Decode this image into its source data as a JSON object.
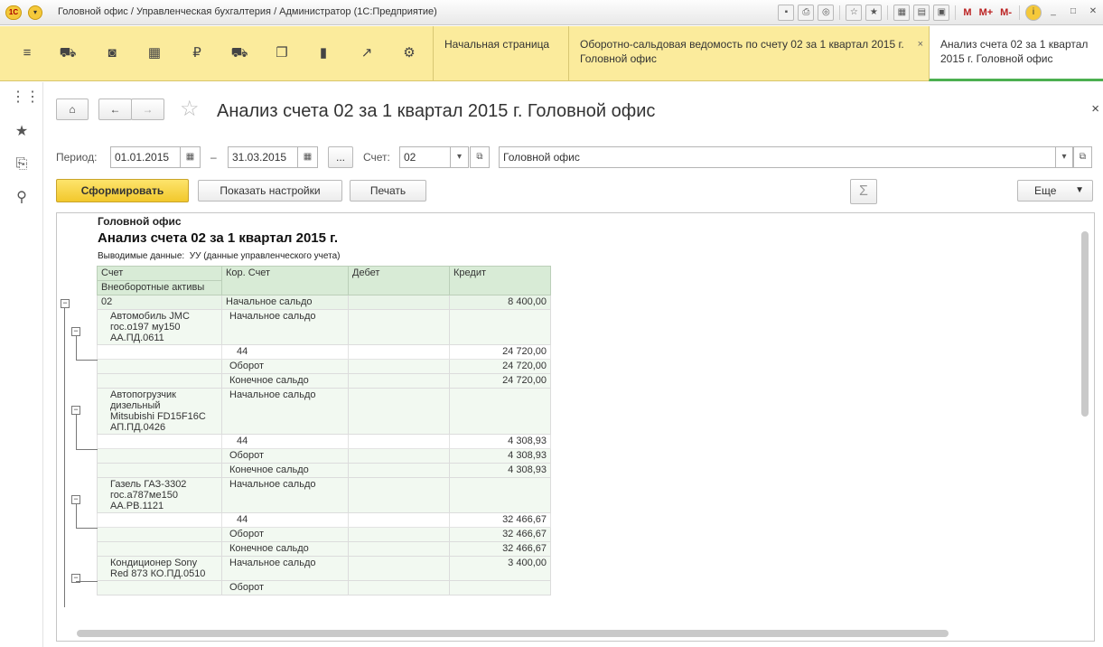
{
  "window": {
    "title": "Головной офис / Управленческая бухгалтерия / Администратор  (1С:Предприятие)",
    "logo_text": "1С",
    "toolbar_labels": [
      "M",
      "M+",
      "M-"
    ]
  },
  "top_sections": {
    "tabs": [
      {
        "label": "Начальная страница"
      },
      {
        "label": "Оборотно-сальдовая ведомость по счету 02 за 1 квартал 2015 г. Головной офис",
        "close": "×"
      },
      {
        "label": "Анализ счета 02 за 1 квартал 2015 г. Головной офис"
      }
    ]
  },
  "form": {
    "title": "Анализ счета 02 за 1 квартал 2015 г. Головной офис",
    "close": "×",
    "period_label": "Период:",
    "date_from": "01.01.2015",
    "dash": "–",
    "date_to": "31.03.2015",
    "ellipsis": "...",
    "account_label": "Счет:",
    "account": "02",
    "organization": "Головной офис",
    "generate_btn": "Сформировать",
    "settings_btn": "Показать настройки",
    "print_btn": "Печать",
    "sum_icon": "Σ",
    "more_btn": "Еще"
  },
  "report": {
    "org": "Головной офис",
    "title": "Анализ счета 02 за 1 квартал 2015 г.",
    "output_line": "Выводимые данные:  УУ (данные управленческого учета)",
    "headers": {
      "account": "Счет",
      "corr": "Кор. Счет",
      "debit": "Дебет",
      "credit": "Кредит",
      "group": "Внеоборотные активы"
    },
    "rows": [
      {
        "kind": "acc",
        "c1": "02",
        "c2": "Начальное сальдо",
        "c3": "",
        "c4": "8 400,00"
      },
      {
        "kind": "sub",
        "c1": "Автомобиль JMC\nгос.о197 му150\nАА.ПД.0611",
        "c2": "Начальное сальдо",
        "c3": "",
        "c4": "",
        "lines": 3
      },
      {
        "kind": "plain",
        "c1": "",
        "c2": "44",
        "c3": "",
        "c4": "24 720,00",
        "indent": true
      },
      {
        "kind": "sub",
        "c1": "",
        "c2": "Оборот",
        "c3": "",
        "c4": "24 720,00"
      },
      {
        "kind": "sub",
        "c1": "",
        "c2": "Конечное сальдо",
        "c3": "",
        "c4": "24 720,00"
      },
      {
        "kind": "sub",
        "c1": "Автопогрузчик\nдизельный\nMitsubishi FD15F16C\nАП.ПД.0426",
        "c2": "Начальное сальдо",
        "c3": "",
        "c4": "",
        "lines": 4
      },
      {
        "kind": "plain",
        "c1": "",
        "c2": "44",
        "c3": "",
        "c4": "4 308,93",
        "indent": true
      },
      {
        "kind": "sub",
        "c1": "",
        "c2": "Оборот",
        "c3": "",
        "c4": "4 308,93"
      },
      {
        "kind": "sub",
        "c1": "",
        "c2": "Конечное сальдо",
        "c3": "",
        "c4": "4 308,93"
      },
      {
        "kind": "sub",
        "c1": "Газель ГАЗ-3302\nгос.а787ме150\nАА.РВ.1121",
        "c2": "Начальное сальдо",
        "c3": "",
        "c4": "",
        "lines": 3
      },
      {
        "kind": "plain",
        "c1": "",
        "c2": "44",
        "c3": "",
        "c4": "32 466,67",
        "indent": true
      },
      {
        "kind": "sub",
        "c1": "",
        "c2": "Оборот",
        "c3": "",
        "c4": "32 466,67"
      },
      {
        "kind": "sub",
        "c1": "",
        "c2": "Конечное сальдо",
        "c3": "",
        "c4": "32 466,67"
      },
      {
        "kind": "sub",
        "c1": "Кондиционер Sony\nRed 873 КО.ПД.0510",
        "c2": "Начальное сальдо",
        "c3": "",
        "c4": "3 400,00",
        "lines": 2
      },
      {
        "kind": "sub",
        "c1": "",
        "c2": "Оборот",
        "c3": "",
        "c4": ""
      }
    ]
  }
}
